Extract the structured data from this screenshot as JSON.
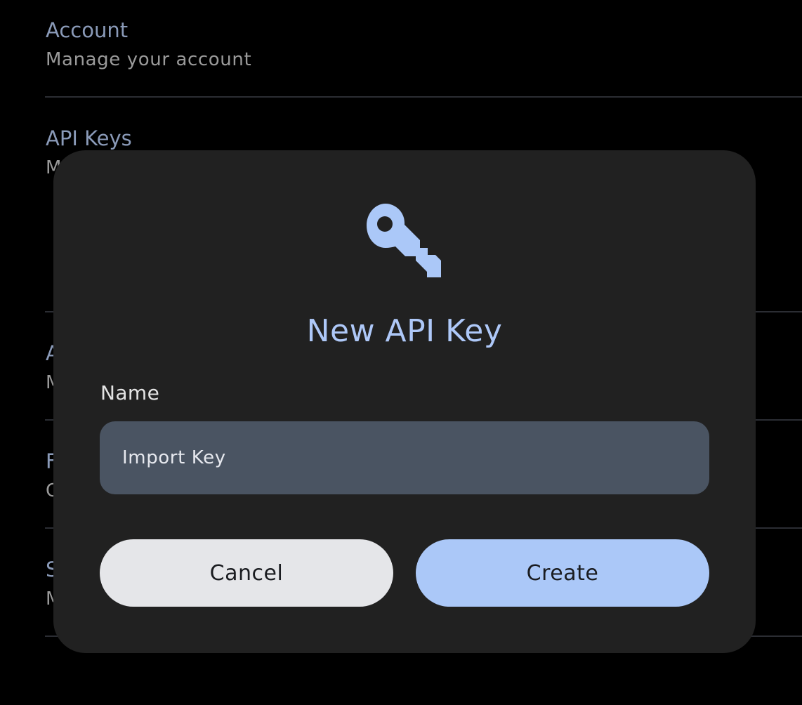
{
  "settings": {
    "sections": [
      {
        "title": "Account",
        "subtitle": "Manage your account"
      },
      {
        "title": "API Keys",
        "subtitle": "M"
      },
      {
        "title": "A",
        "subtitle": "M"
      },
      {
        "title": "F",
        "subtitle": "C"
      },
      {
        "title": "S",
        "subtitle": "M"
      }
    ]
  },
  "dialog": {
    "icon": "key-icon",
    "title": "New API Key",
    "name_label": "Name",
    "name_value": "Import Key",
    "cancel_label": "Cancel",
    "create_label": "Create"
  },
  "colors": {
    "background": "#000000",
    "dialog_background": "#212121",
    "accent": "#abc8f8",
    "section_title": "#8a9ab8",
    "input_background": "#4a5462"
  }
}
